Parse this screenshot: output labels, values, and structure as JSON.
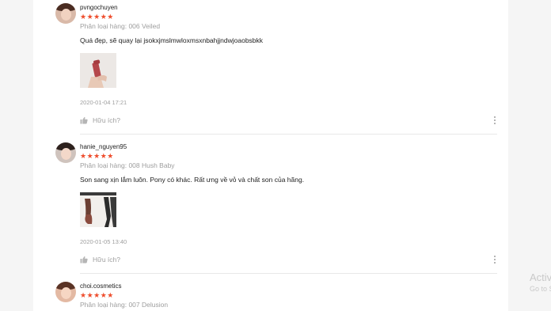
{
  "reviews": [
    {
      "username": "pvngochuyen",
      "stars": "★★★★★",
      "variation": "Phân loại hàng: 006 Veiled",
      "comment": "Quá đẹp, sẽ quay lại jsokxjmslmwloxmsxnbahjjndwjoaobsbkk",
      "timestamp": "2020-01-04 17:21",
      "helpful_label": "Hữu ích?"
    },
    {
      "username": "hanie_nguyen95",
      "stars": "★★★★★",
      "variation": "Phân loại hàng: 008 Hush Baby",
      "comment": "Son sang xịn lắm luôn. Pony có khác. Rất ưng về vỏ và chất son của hãng.",
      "timestamp": "2020-01-05 13:40",
      "helpful_label": "Hữu ích?"
    },
    {
      "username": "choi.cosmetics",
      "stars": "★★★★★",
      "variation": "Phân loại hàng: 007 Delusion"
    }
  ],
  "watermark": {
    "title": "Activ",
    "subtitle": "Go to S"
  },
  "colors": {
    "star": "#ee4d2d",
    "muted_text": "#9e9e9e",
    "panel": "#ffffff",
    "page_bg": "#f5f5f5"
  }
}
